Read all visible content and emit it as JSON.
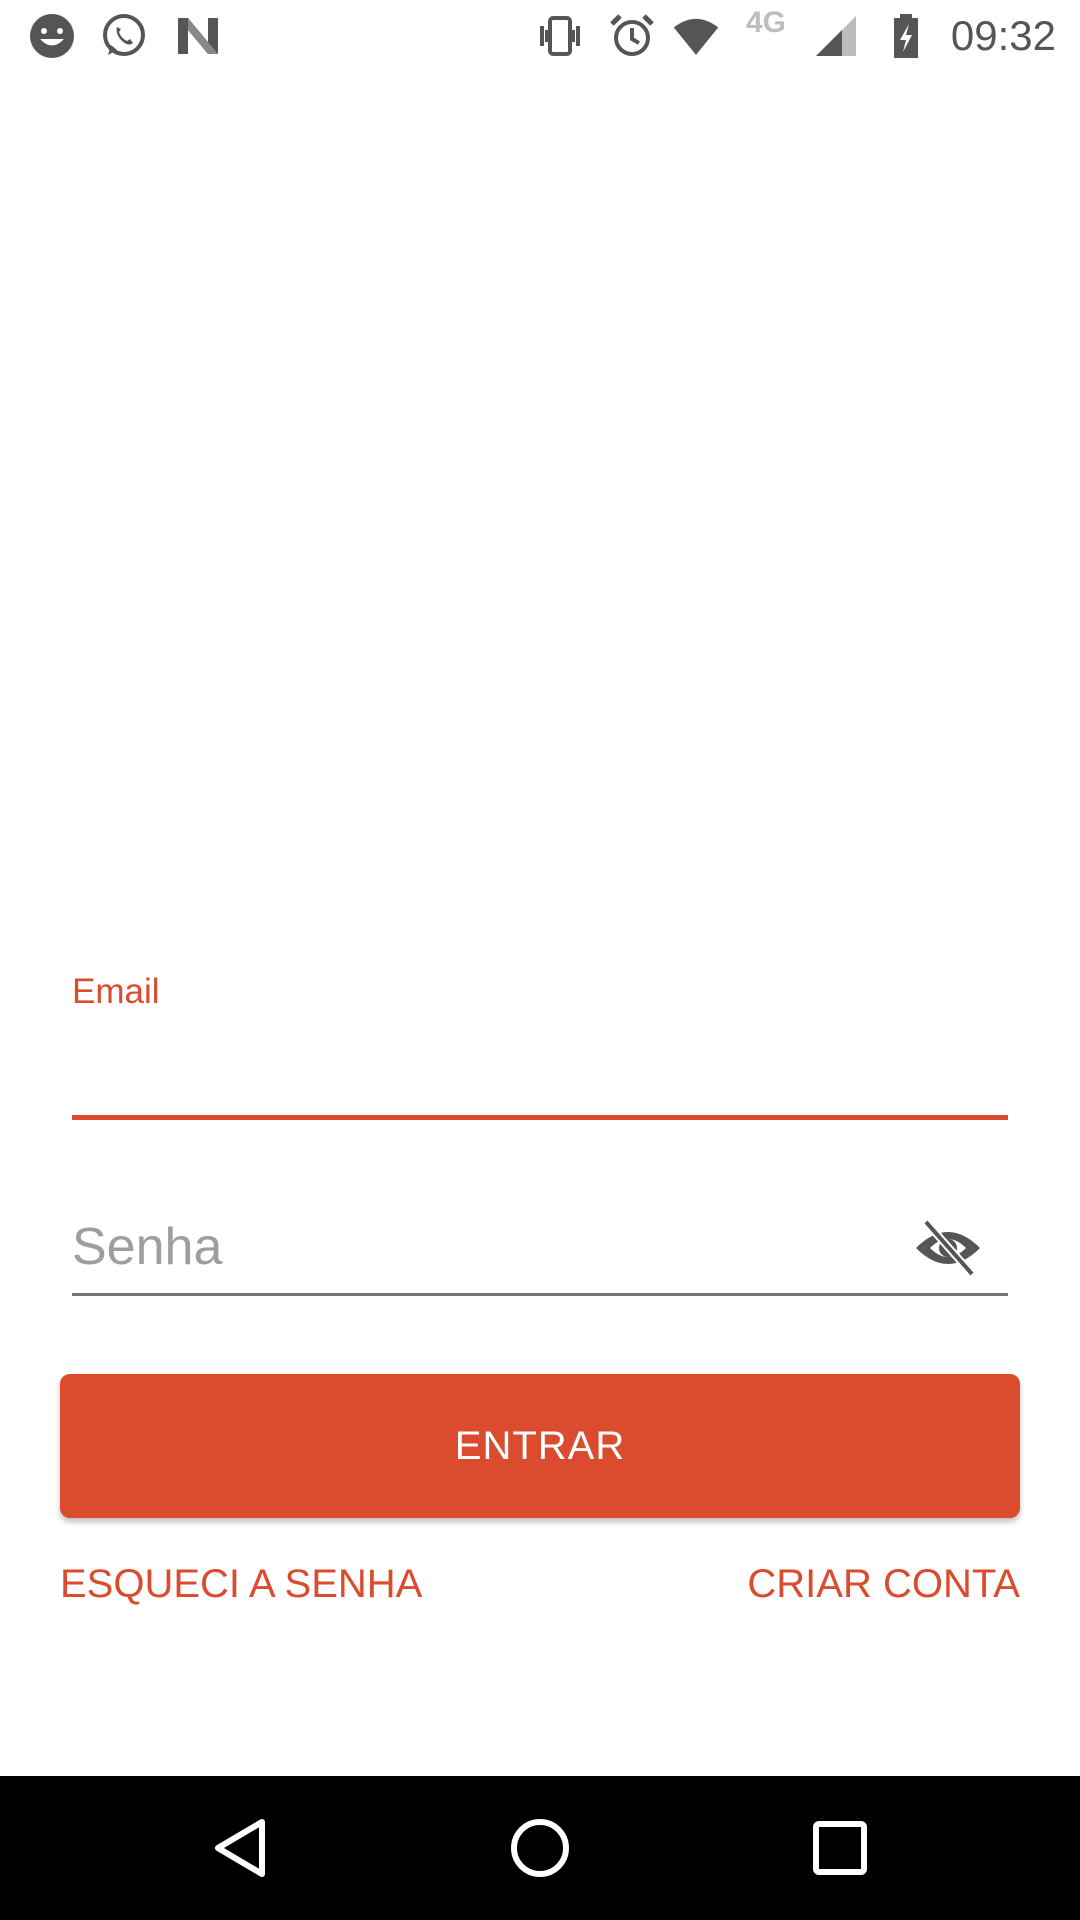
{
  "status_bar": {
    "time": "09:32",
    "network_label": "4G",
    "icons": [
      "smiley-notification-icon",
      "whatsapp-icon",
      "n-app-icon",
      "vibrate-icon",
      "alarm-icon",
      "wifi-icon",
      "cell-signal-icon",
      "battery-charging-icon"
    ]
  },
  "form": {
    "email_label": "Email",
    "email_value": "",
    "password_placeholder": "Senha",
    "password_value": "",
    "visibility_icon": "visibility-off-icon",
    "login_label": "ENTRAR",
    "forgot_label": "ESQUECI A SENHA",
    "create_label": "CRIAR CONTA"
  },
  "nav_bar": {
    "icons": [
      "back-icon",
      "home-icon",
      "recents-icon"
    ]
  },
  "colors": {
    "accent": "#db4b2e",
    "text_secondary": "#9e9e9e",
    "status_icons": "#555555"
  }
}
